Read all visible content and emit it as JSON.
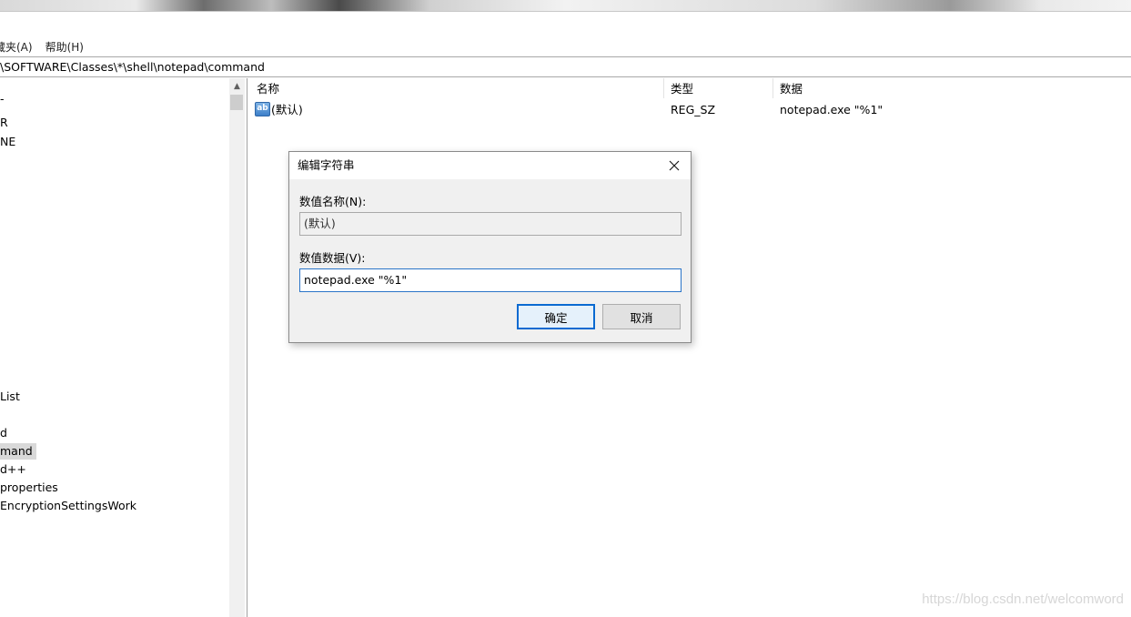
{
  "menubar": {
    "items": [
      "藏夹(A)",
      "帮助(H)"
    ]
  },
  "address": {
    "path": "\\SOFTWARE\\Classes\\*\\shell\\notepad\\command"
  },
  "tree": {
    "items": [
      {
        "label": "-",
        "selected": false
      },
      {
        "label": "R",
        "selected": false
      },
      {
        "label": "NE",
        "selected": false
      },
      {
        "label": "List",
        "selected": false
      },
      {
        "label": "d",
        "selected": false
      },
      {
        "label": "mand",
        "selected": true
      },
      {
        "label": "d++",
        "selected": false
      },
      {
        "label": "properties",
        "selected": false
      },
      {
        "label": "EncryptionSettingsWork",
        "selected": false
      }
    ]
  },
  "list": {
    "columns": [
      "名称",
      "类型",
      "数据"
    ],
    "rows": [
      {
        "icon": "string-value-icon",
        "icon_text": "ab",
        "name": "(默认)",
        "type": "REG_SZ",
        "data": "notepad.exe \"%1\""
      }
    ]
  },
  "dialog": {
    "title": "编辑字符串",
    "name_label": "数值名称(N):",
    "name_value": "(默认)",
    "data_label": "数值数据(V):",
    "data_value": "notepad.exe \"%1\"",
    "ok_label": "确定",
    "cancel_label": "取消"
  },
  "watermark": "https://blog.csdn.net/welcomword",
  "colors": {
    "selection": "#d9d9d9",
    "focus_border": "#2a74c8",
    "default_button_border": "#0a6ad1"
  }
}
